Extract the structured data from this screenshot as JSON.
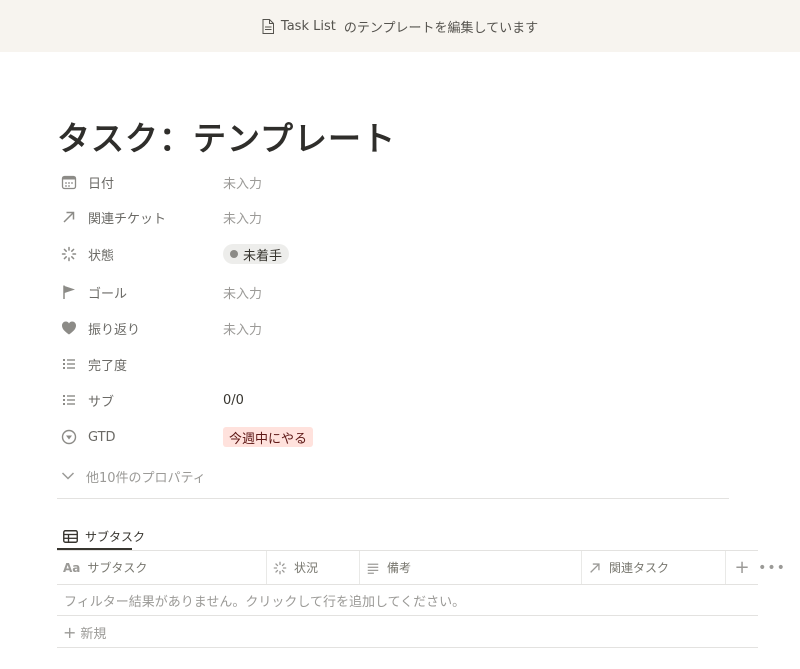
{
  "banner": {
    "page_name": "Task List",
    "message": "のテンプレートを編集しています"
  },
  "page": {
    "title": "タスク：テンプレート"
  },
  "properties": [
    {
      "name": "日付",
      "icon": "calendar-icon",
      "value": "未入力"
    },
    {
      "name": "関連チケット",
      "icon": "relation-arrow-icon",
      "value": "未入力"
    },
    {
      "name": "状態",
      "icon": "status-icon",
      "value": "未着手"
    },
    {
      "name": "ゴール",
      "icon": "flag-icon",
      "value": "未入力"
    },
    {
      "name": "振り返り",
      "icon": "heart-icon",
      "value": "未入力"
    },
    {
      "name": "完了度",
      "icon": "list-icon",
      "value": ""
    },
    {
      "name": "サブ",
      "icon": "list-icon",
      "value": "0/0"
    },
    {
      "name": "GTD",
      "icon": "select-icon",
      "value": "今週中にやる"
    }
  ],
  "more_properties_label": "他10件のプロパティ",
  "colors": {
    "status_pill_bg": "#ededeb",
    "gtd_tag_bg": "#ffe2dd",
    "gtd_tag_text": "#5d1715"
  },
  "database": {
    "view_tab_label": "サブタスク",
    "columns": [
      {
        "label": "サブタスク",
        "icon": "text-aa-icon"
      },
      {
        "label": "状況",
        "icon": "status-icon"
      },
      {
        "label": "備考",
        "icon": "text-lines-icon"
      },
      {
        "label": "関連タスク",
        "icon": "relation-arrow-icon"
      }
    ],
    "add_column_label": "+",
    "more_label": "•••",
    "empty_message": "フィルター結果がありません。クリックして行を追加してください。",
    "new_row_label": "新規",
    "new_row_icon": "+"
  }
}
